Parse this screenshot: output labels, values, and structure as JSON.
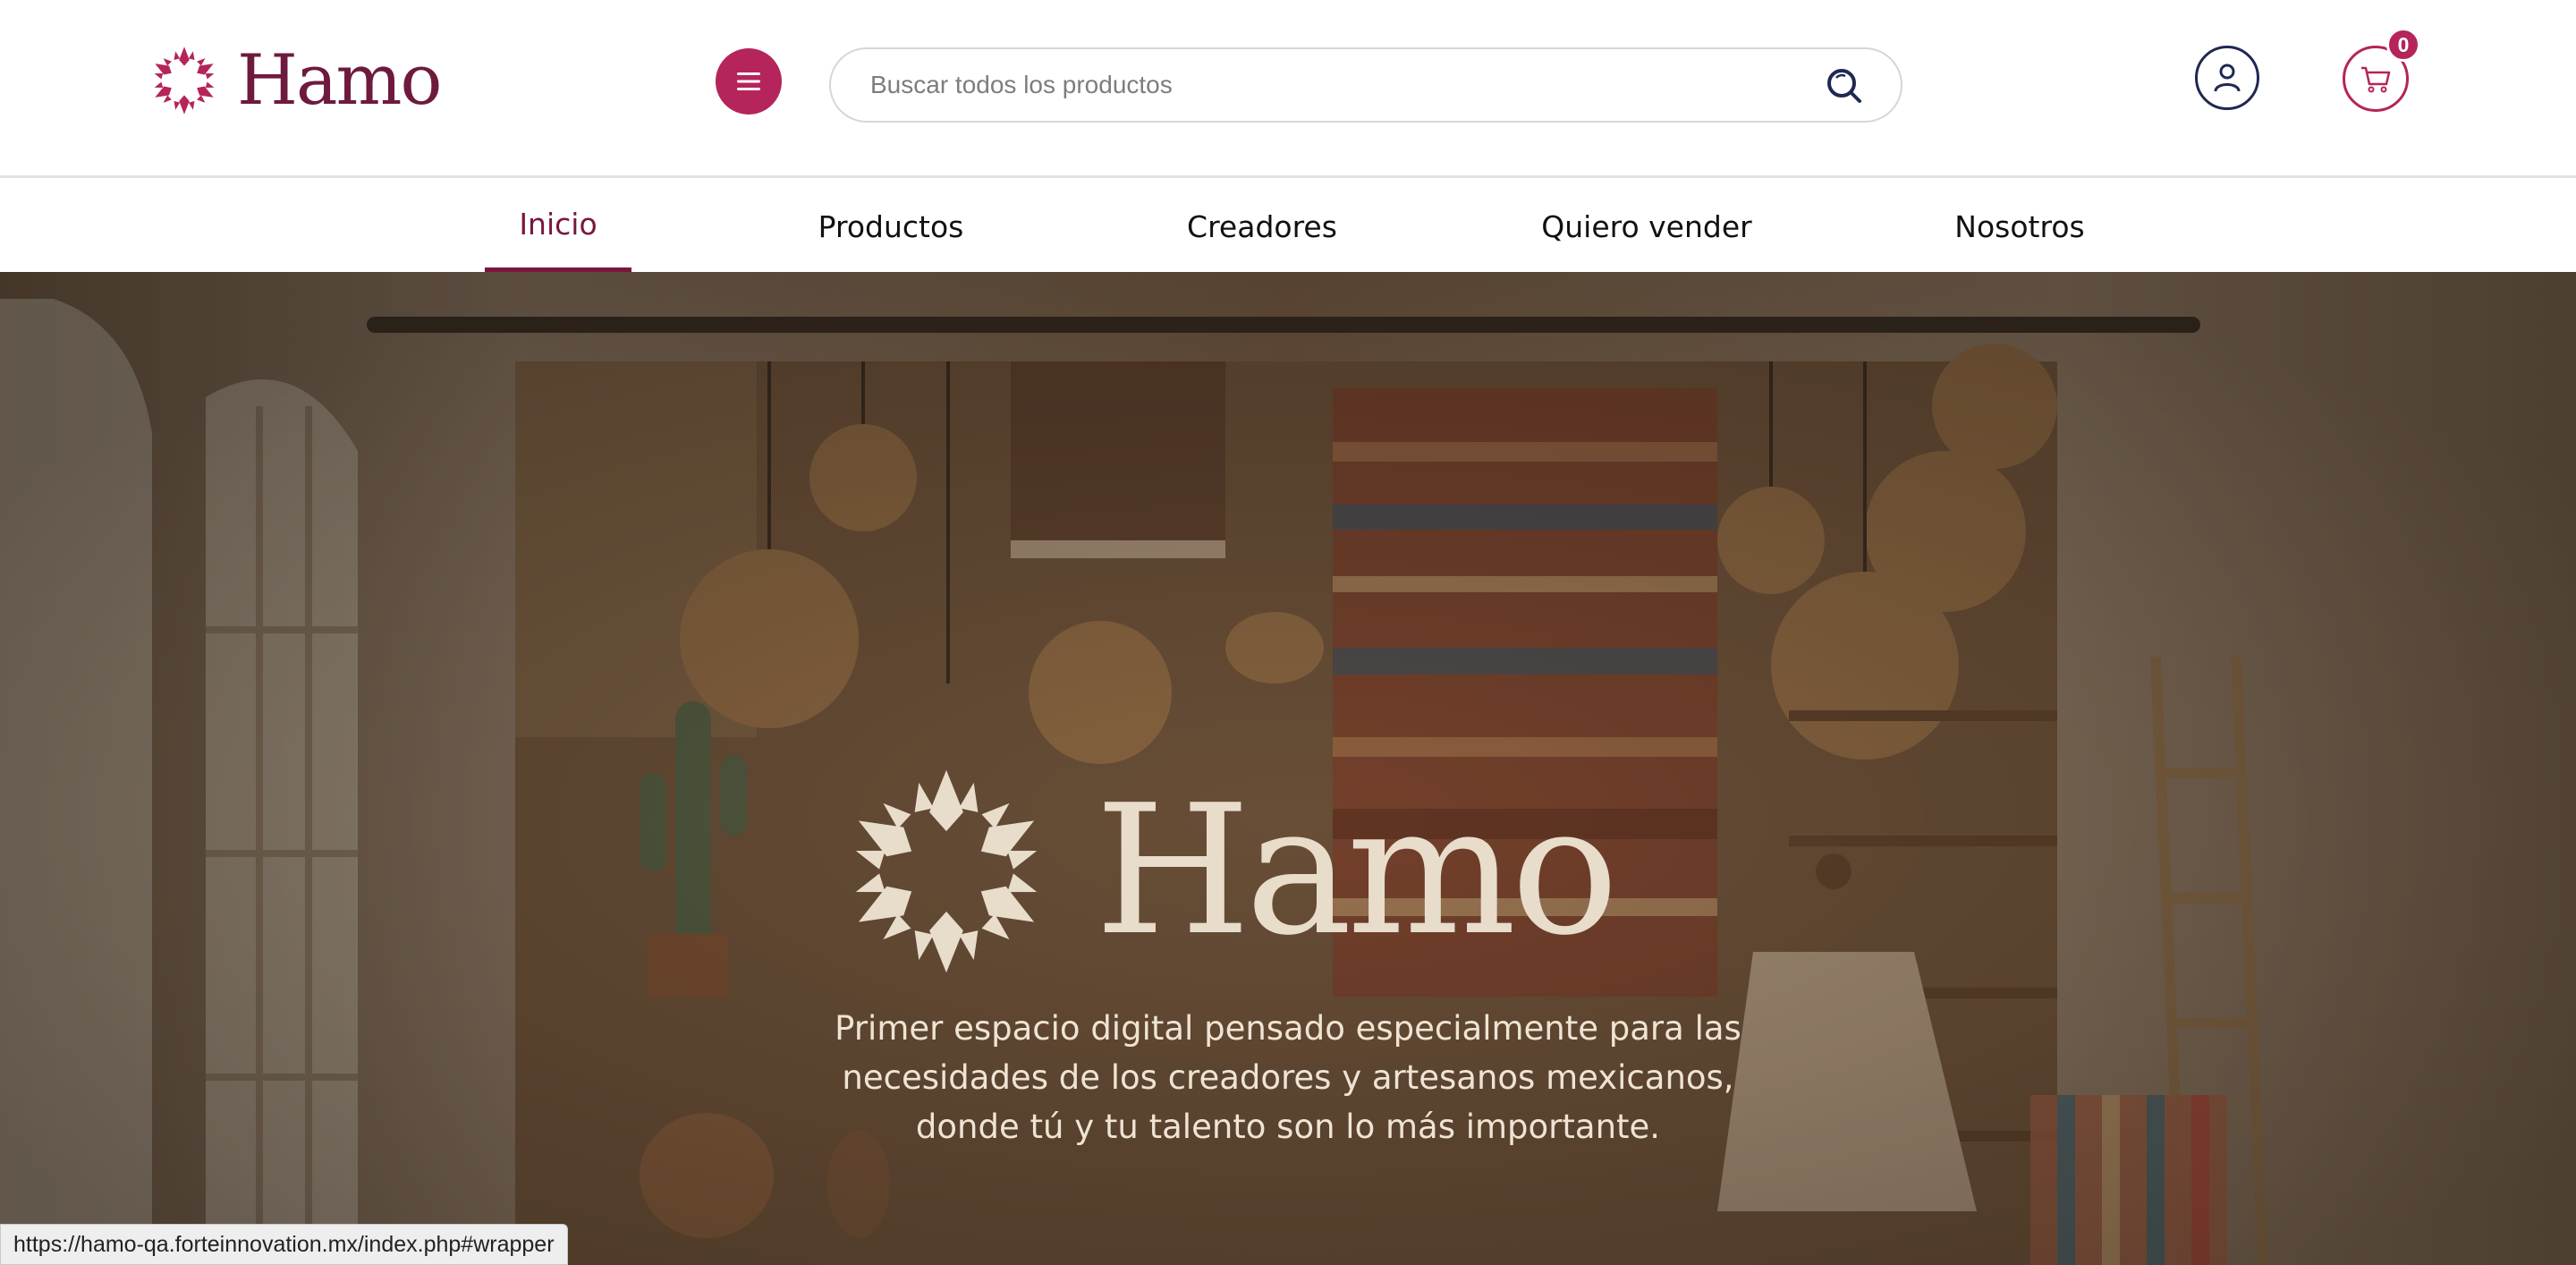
{
  "brand": {
    "name": "Hamo",
    "color": "#b5245a",
    "dark_color": "#6e1a3f"
  },
  "header": {
    "menu_icon": "hamburger-menu-icon",
    "search": {
      "placeholder": "Buscar todos los productos",
      "value": "",
      "icon": "search-icon"
    },
    "user_icon": "user-account-icon",
    "cart": {
      "icon": "shopping-cart-icon",
      "count": "0"
    }
  },
  "nav": {
    "items": [
      {
        "label": "Inicio",
        "active": true
      },
      {
        "label": "Productos",
        "active": false
      },
      {
        "label": "Creadores",
        "active": false
      },
      {
        "label": "Quiero vender",
        "active": false
      },
      {
        "label": "Nosotros",
        "active": false
      }
    ]
  },
  "hero": {
    "logo_text": "Hamo",
    "tagline_lines": [
      "Primer espacio digital pensado especialmente para las",
      "necesidades de los creadores y artesanos mexicanos,",
      "donde tú y tu talento son lo más importante."
    ]
  },
  "status_bar": {
    "url": "https://hamo-qa.forteinnovation.mx/index.php#wrapper"
  }
}
